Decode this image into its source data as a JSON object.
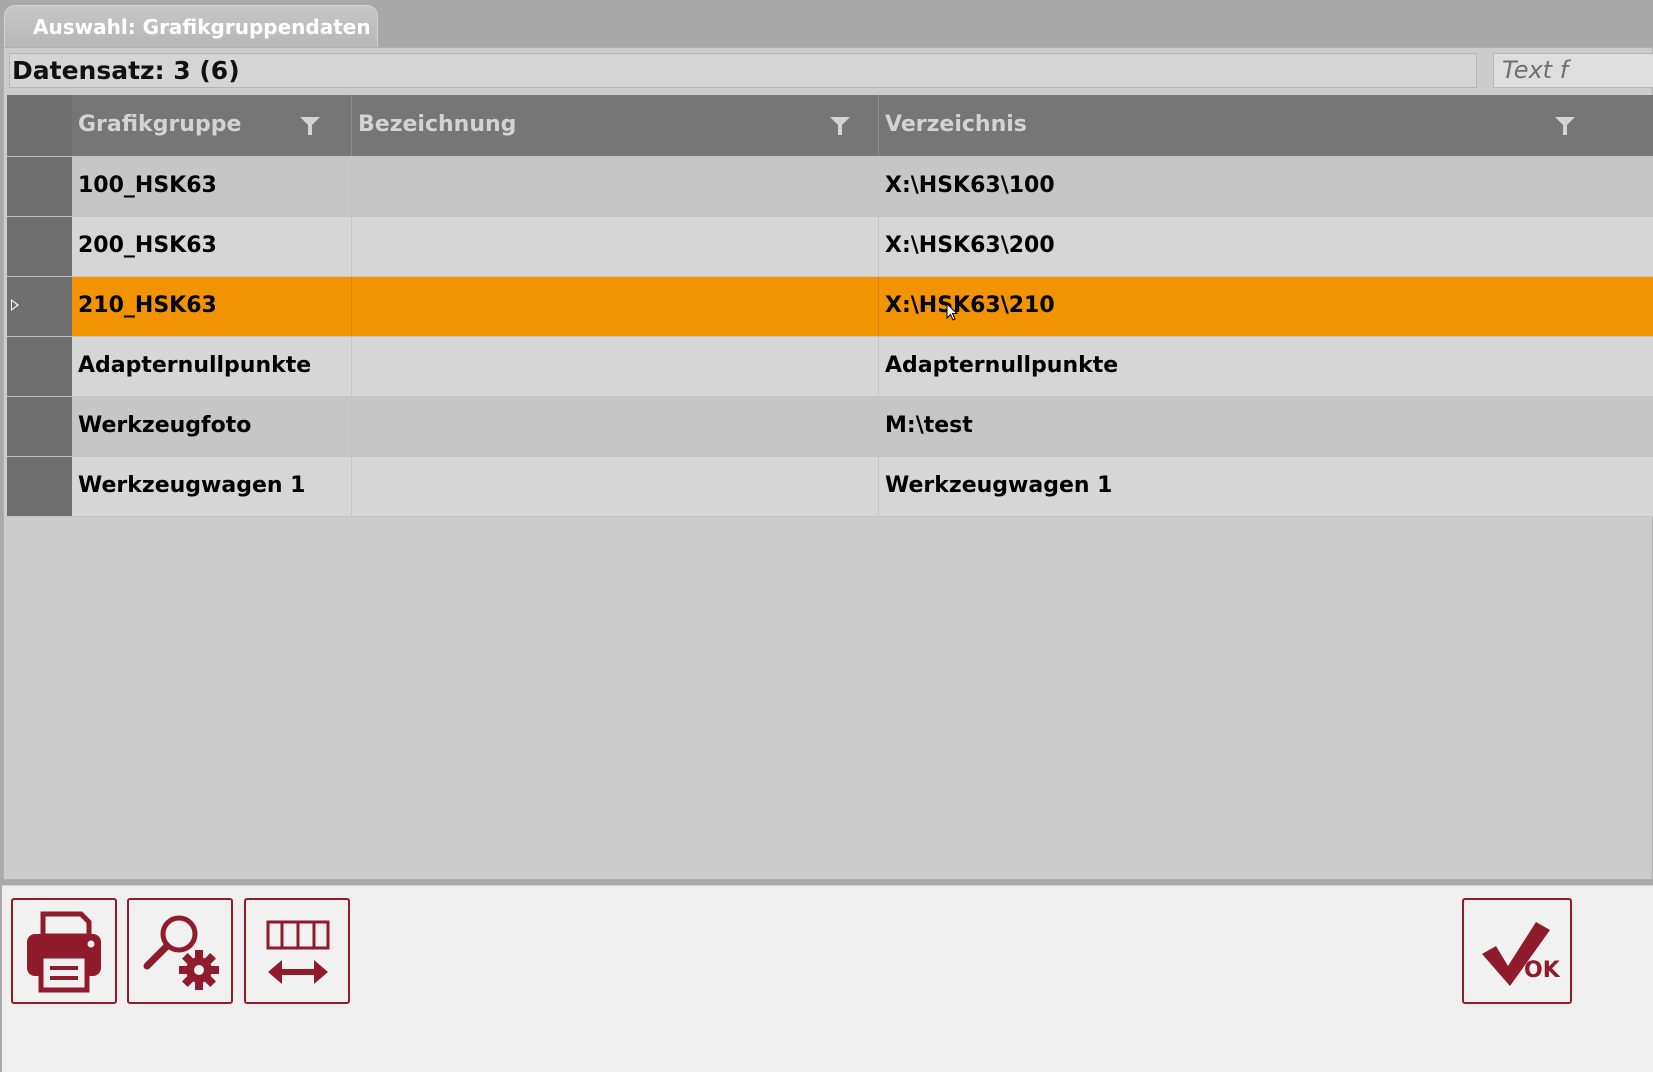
{
  "window": {
    "tab_title": "Auswahl: Grafikgruppendaten"
  },
  "record_info": "Datensatz: 3 (6)",
  "search": {
    "placeholder": "Text f"
  },
  "table": {
    "columns": [
      "Grafikgruppe",
      "Bezeichnung",
      "Verzeichnis"
    ],
    "rows": [
      {
        "grafikgruppe": "100_HSK63",
        "bezeichnung": "",
        "verzeichnis": "X:\\HSK63\\100"
      },
      {
        "grafikgruppe": "200_HSK63",
        "bezeichnung": "",
        "verzeichnis": "X:\\HSK63\\200"
      },
      {
        "grafikgruppe": "210_HSK63",
        "bezeichnung": "",
        "verzeichnis": "X:\\HSK63\\210",
        "selected": true
      },
      {
        "grafikgruppe": "Adapternullpunkte",
        "bezeichnung": "",
        "verzeichnis": "Adapternullpunkte"
      },
      {
        "grafikgruppe": "Werkzeugfoto",
        "bezeichnung": "",
        "verzeichnis": "M:\\test"
      },
      {
        "grafikgruppe": "Werkzeugwagen 1",
        "bezeichnung": "",
        "verzeichnis": "Werkzeugwagen 1"
      }
    ]
  },
  "toolbar": {
    "buttons": [
      "print-icon",
      "search-settings-icon",
      "column-width-icon"
    ],
    "ok_label": "OK"
  },
  "colors": {
    "selection": "#f29302",
    "accent": "#8f1b2c",
    "header": "#767676"
  }
}
